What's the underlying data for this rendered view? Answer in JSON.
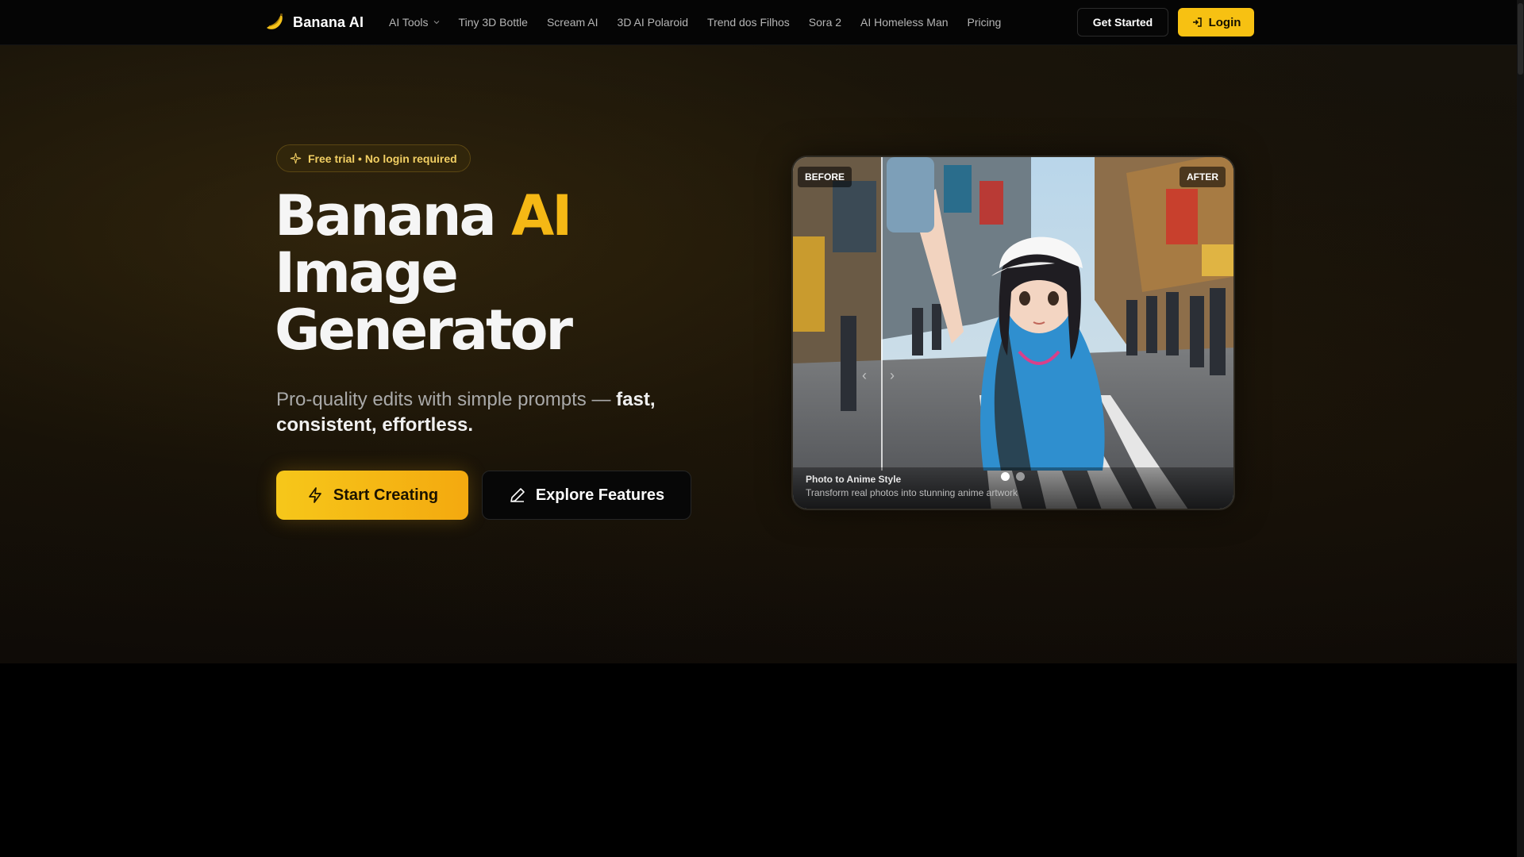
{
  "nav": {
    "brand": "Banana AI",
    "links": [
      {
        "label": "AI Tools",
        "dropdown": true
      },
      {
        "label": "Tiny 3D Bottle"
      },
      {
        "label": "Scream AI"
      },
      {
        "label": "3D AI Polaroid"
      },
      {
        "label": "Trend dos Filhos"
      },
      {
        "label": "Sora 2"
      },
      {
        "label": "AI Homeless Man"
      },
      {
        "label": "Pricing"
      }
    ],
    "get_started": "Get Started",
    "login": "Login"
  },
  "hero": {
    "badge": "Free trial • No login required",
    "title_part1": "Banana ",
    "title_accent": "AI",
    "title_line2": "Image",
    "title_line3": "Generator",
    "sub_plain": "Pro-quality edits with simple prompts — ",
    "sub_strong": "fast, consistent, effortless.",
    "start_label": "Start Creating",
    "explore_label": "Explore Features"
  },
  "showcase": {
    "before": "BEFORE",
    "after": "AFTER",
    "caption_title": "Photo to Anime Style",
    "caption_desc": "Transform real photos into stunning anime artwork",
    "slides": 2,
    "active_slide": 1
  },
  "colors": {
    "accent": "#f5b815",
    "button": "#f7c112",
    "background": "#000000"
  }
}
